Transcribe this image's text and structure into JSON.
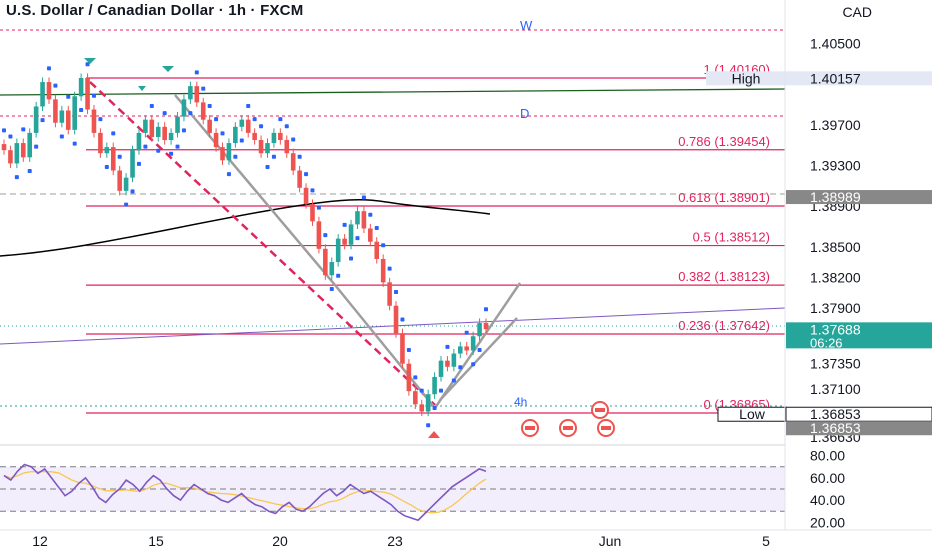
{
  "header": {
    "title": "U.S. Dollar / Canadian Dollar · 1h · FXCM",
    "currency": "CAD"
  },
  "colors": {
    "fib": "#e0245e",
    "sar": "#2962ff",
    "up": "#26a69a",
    "down": "#ef5350",
    "ma": "#000000",
    "trendline": "#1b5e20",
    "pattern": "#9e9e9e",
    "channel": "#7e57c2",
    "rsi": "#7e57c2",
    "rsi_ma": "#f9c74f",
    "price_badge": "#26a69a"
  },
  "chart_data": [
    {
      "type": "candlestick",
      "symbol": "U.S. Dollar / Canadian Dollar",
      "timeframe": "1h",
      "source": "FXCM",
      "y_axis_ticks": [
        "1.40500",
        "1.39700",
        "1.39300",
        "1.38900",
        "1.38500",
        "1.38200",
        "1.37900",
        "1.37350",
        "1.37100",
        "1.36630"
      ],
      "x_axis_ticks": [
        "12",
        "15",
        "20",
        "23",
        "Jun",
        "5"
      ],
      "fib_levels": [
        {
          "label": "1 (1.40160)",
          "value": 1.4016
        },
        {
          "label": "0.786 (1.39454)",
          "value": 1.39454
        },
        {
          "label": "0.618 (1.38901)",
          "value": 1.38901
        },
        {
          "label": "0.5 (1.38512)",
          "value": 1.38512
        },
        {
          "label": "0.382 (1.38123)",
          "value": 1.38123
        },
        {
          "label": "0.236 (1.37642)",
          "value": 1.37642
        },
        {
          "label": "0 (1.36865)",
          "value": 1.36865
        }
      ],
      "price_labels": [
        {
          "name": "High",
          "text": "High",
          "value": "1.40157"
        },
        {
          "name": "level",
          "text": "",
          "value": "1.38989"
        },
        {
          "name": "current",
          "text": "06:26",
          "value": "1.37688"
        },
        {
          "name": "Low",
          "text": "Low",
          "value": "1.36853"
        },
        {
          "name": "low2",
          "text": "",
          "value": "1.36853"
        }
      ],
      "pattern_labels": {
        "w": "W",
        "d": "D",
        "h": "4h"
      },
      "close_series": [
        1.3945,
        1.3932,
        1.3952,
        1.3938,
        1.3962,
        1.3988,
        1.4012,
        1.3995,
        1.3972,
        1.3984,
        1.3965,
        1.3998,
        1.4016,
        1.3985,
        1.3962,
        1.3942,
        1.3948,
        1.3925,
        1.3905,
        1.3918,
        1.3945,
        1.3962,
        1.3975,
        1.3958,
        1.3968,
        1.3955,
        1.3962,
        1.3978,
        1.3995,
        1.4008,
        1.3992,
        1.3975,
        1.3962,
        1.3948,
        1.3935,
        1.3952,
        1.3968,
        1.3975,
        1.3962,
        1.3955,
        1.3942,
        1.3952,
        1.3962,
        1.3955,
        1.3942,
        1.3925,
        1.3908,
        1.3892,
        1.3875,
        1.3848,
        1.3822,
        1.3835,
        1.3858,
        1.3852,
        1.3872,
        1.3885,
        1.3868,
        1.3855,
        1.3838,
        1.3815,
        1.3792,
        1.3765,
        1.3735,
        1.3708,
        1.3695,
        1.3688,
        1.3705,
        1.3722,
        1.3738,
        1.3732,
        1.3745,
        1.3752,
        1.3748,
        1.3762,
        1.3775,
        1.3769
      ]
    },
    {
      "type": "line",
      "name": "RSI",
      "y_axis_ticks": [
        "80.00",
        "60.00",
        "40.00",
        "20.00"
      ],
      "ylim": [
        15,
        85
      ],
      "levels": [
        70,
        50,
        30
      ],
      "values": [
        62,
        58,
        66,
        72,
        70,
        64,
        68,
        60,
        52,
        44,
        48,
        55,
        60,
        52,
        42,
        38,
        45,
        50,
        58,
        54,
        48,
        56,
        62,
        58,
        50,
        44,
        40,
        48,
        54,
        50,
        46,
        44,
        40,
        38,
        42,
        46,
        40,
        36,
        34,
        30,
        28,
        34,
        38,
        32,
        30,
        34,
        40,
        46,
        50,
        44,
        48,
        54,
        50,
        46,
        48,
        44,
        40,
        36,
        30,
        26,
        24,
        22,
        28,
        34,
        40,
        46,
        52,
        56,
        60,
        64,
        68,
        66
      ]
    }
  ]
}
